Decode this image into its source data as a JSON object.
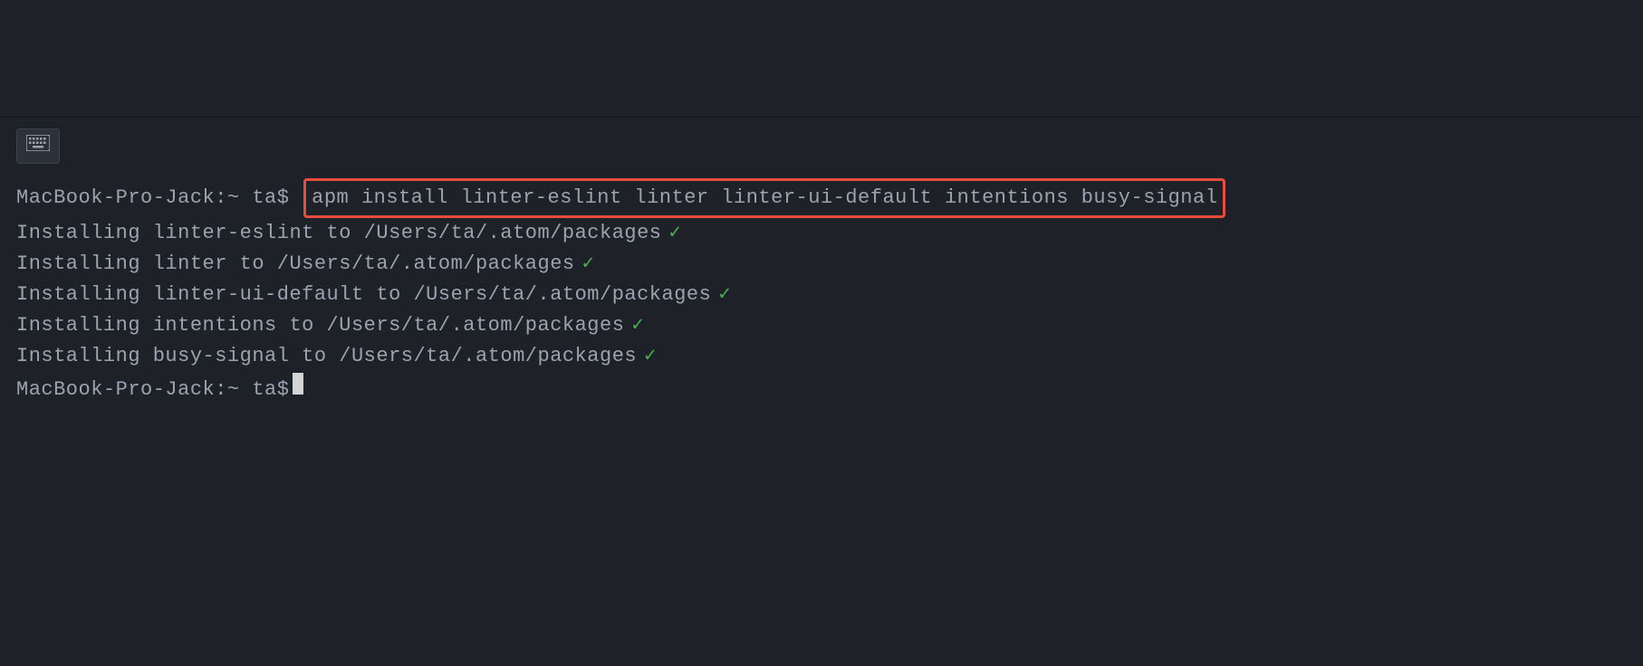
{
  "terminal": {
    "prompt": "MacBook-Pro-Jack:~ ta$ ",
    "command": "apm install linter-eslint linter linter-ui-default intentions busy-signal",
    "output_lines": [
      {
        "text": "Installing linter-eslint to /Users/ta/.atom/packages",
        "check": "✓"
      },
      {
        "text": "Installing linter to /Users/ta/.atom/packages",
        "check": "✓"
      },
      {
        "text": "Installing linter-ui-default to /Users/ta/.atom/packages",
        "check": "✓"
      },
      {
        "text": "Installing intentions to /Users/ta/.atom/packages",
        "check": "✓"
      },
      {
        "text": "Installing busy-signal to /Users/ta/.atom/packages",
        "check": "✓"
      }
    ],
    "prompt2": "MacBook-Pro-Jack:~ ta$"
  }
}
